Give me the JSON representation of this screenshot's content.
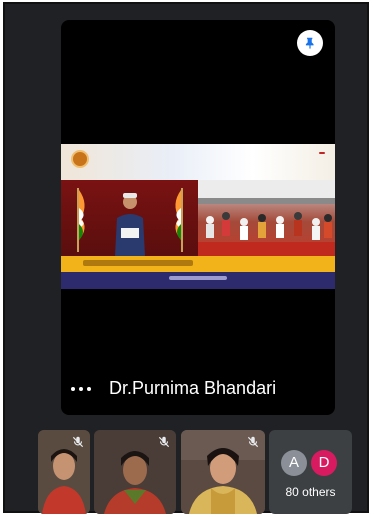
{
  "meeting": {
    "main_speaker": {
      "name": "Dr.Purnima Bhandari"
    },
    "pin_icon": "pin-icon",
    "more_icon": "more-horiz-icon"
  },
  "participants": {
    "thumbnails": [
      {
        "mic": "mic-off-icon"
      },
      {
        "mic": "mic-off-icon"
      },
      {
        "mic": "mic-off-icon"
      }
    ],
    "others": {
      "avatars": [
        {
          "initial": "A",
          "color": "#8a8f98"
        },
        {
          "initial": "D",
          "color": "#d81b60"
        }
      ],
      "label": "80 others"
    }
  },
  "colors": {
    "background": "#202124",
    "tile": "#3c4043"
  }
}
